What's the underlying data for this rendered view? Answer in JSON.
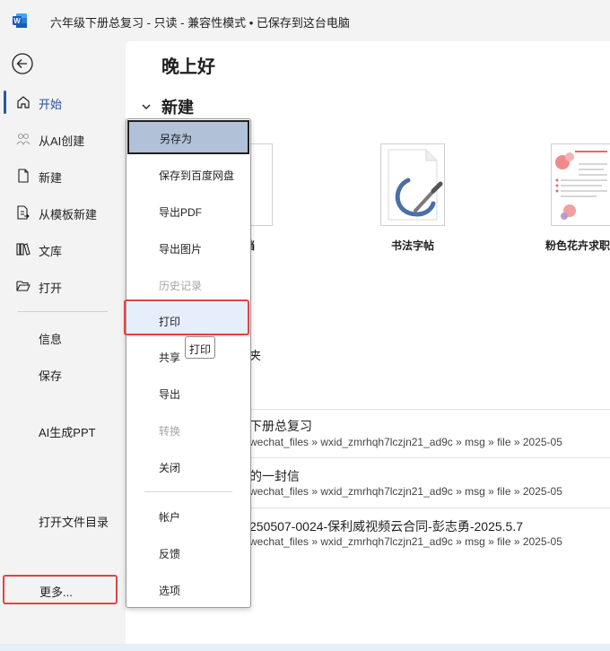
{
  "titlebar": {
    "app_icon": "word-logo-icon",
    "title": "六年级下册总复习  -  只读  -  兼容性模式 • 已保存到这台电脑"
  },
  "sidebar": {
    "back_icon": "back-arrow-icon",
    "items": [
      {
        "label": "开始",
        "icon": "home-icon",
        "active": true
      },
      {
        "label": "从AI创建",
        "icon": "ai-people-icon"
      },
      {
        "label": "新建",
        "icon": "new-document-icon"
      },
      {
        "label": "从模板新建",
        "icon": "template-document-icon"
      },
      {
        "label": "文库",
        "icon": "library-books-icon"
      },
      {
        "label": "打开",
        "icon": "folder-open-icon"
      },
      {
        "label": "信息"
      },
      {
        "label": "保存"
      },
      {
        "label": "AI生成PPT"
      },
      {
        "label": "打开文件目录"
      }
    ],
    "more_label": "更多..."
  },
  "main": {
    "greeting": "晚上好",
    "new_section_label": "新建",
    "templates": [
      {
        "name": "文档"
      },
      {
        "name": "书法字帖",
        "icon": "calligraphy-brush-icon"
      },
      {
        "name": "粉色花卉求职"
      }
    ],
    "partial_text": "夹",
    "recent": [
      {
        "title": "下册总复习",
        "path": "wechat_files » wxid_zmrhqh7lczjn21_ad9c » msg » file » 2025-05"
      },
      {
        "title": "的一封信",
        "path": "wechat_files » wxid_zmrhqh7lczjn21_ad9c » msg » file » 2025-05"
      },
      {
        "title": "250507-0024-保利威视频云合同-彭志勇-2025.5.7",
        "path": "wechat_files » wxid_zmrhqh7lczjn21_ad9c » msg » file » 2025-05"
      }
    ]
  },
  "menu": {
    "items": [
      {
        "label": "另存为",
        "state": "selected"
      },
      {
        "label": "保存到百度网盘"
      },
      {
        "label": "导出PDF"
      },
      {
        "label": "导出图片"
      },
      {
        "label": "历史记录",
        "state": "disabled"
      },
      {
        "label": "打印",
        "state": "hover"
      },
      {
        "label": "共享"
      },
      {
        "label": "导出"
      },
      {
        "label": "转换",
        "state": "disabled"
      },
      {
        "label": "关闭"
      },
      {
        "label": "帐户"
      },
      {
        "label": "反馈"
      },
      {
        "label": "选项"
      }
    ],
    "tooltip": "打印"
  }
}
